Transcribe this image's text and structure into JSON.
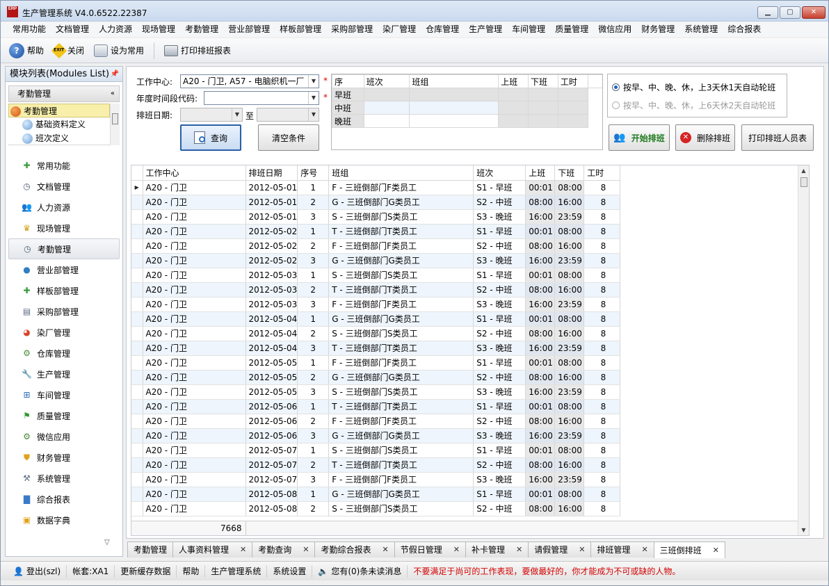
{
  "window": {
    "title": "生产管理系统 V4.0.6522.22387",
    "logo_text": "ERP"
  },
  "menu": [
    "常用功能",
    "文档管理",
    "人力资源",
    "现场管理",
    "考勤管理",
    "营业部管理",
    "样板部管理",
    "采购部管理",
    "染厂管理",
    "仓库管理",
    "生产管理",
    "车间管理",
    "质量管理",
    "微信应用",
    "财务管理",
    "系统管理",
    "综合报表"
  ],
  "toolbar": {
    "help": "帮助",
    "close": "关闭",
    "set_common": "设为常用",
    "print_report": "打印排班报表",
    "exit_badge": "EXIT"
  },
  "sidebar": {
    "title": "模块列表(Modules List)",
    "section": "考勤管理",
    "tree": [
      "考勤管理",
      "基础资料定义",
      "班次定义"
    ],
    "nav": [
      {
        "label": "常用功能",
        "icon": "puzzle-icon"
      },
      {
        "label": "文档管理",
        "icon": "clock-icon"
      },
      {
        "label": "人力资源",
        "icon": "people-icon"
      },
      {
        "label": "现场管理",
        "icon": "crown-icon"
      },
      {
        "label": "考勤管理",
        "icon": "clock-icon"
      },
      {
        "label": "营业部管理",
        "icon": "globe-icon"
      },
      {
        "label": "样板部管理",
        "icon": "puzzle-icon"
      },
      {
        "label": "采购部管理",
        "icon": "list-icon"
      },
      {
        "label": "染厂管理",
        "icon": "pie-icon"
      },
      {
        "label": "仓库管理",
        "icon": "gear-icon"
      },
      {
        "label": "生产管理",
        "icon": "wrench-icon"
      },
      {
        "label": "车间管理",
        "icon": "org-icon"
      },
      {
        "label": "质量管理",
        "icon": "flag-icon"
      },
      {
        "label": "微信应用",
        "icon": "gear-icon"
      },
      {
        "label": "财务管理",
        "icon": "shield-icon"
      },
      {
        "label": "系统管理",
        "icon": "tools-icon"
      },
      {
        "label": "综合报表",
        "icon": "bar-chart-icon"
      },
      {
        "label": "数据字典",
        "icon": "cube-icon"
      }
    ]
  },
  "form": {
    "work_center_label": "工作中心:",
    "work_center_value": "A20 - 门卫, A57 - 电脑织机一厂",
    "period_label": "年度时间段代码:",
    "period_value": "",
    "date_label": "排班日期:",
    "date_from": "",
    "date_to": "",
    "to_label": "至",
    "query_button": "查询",
    "clear_button": "清空条件",
    "required_mark": "*"
  },
  "shift_table": {
    "headers": [
      "序",
      "班次",
      "班组",
      "上班",
      "下班",
      "工时"
    ],
    "rows": [
      "早班",
      "中班",
      "晚班"
    ]
  },
  "rotation": {
    "option1": "按早、中、晚、休，上3天休1天自动轮班",
    "option2": "按早、中、晚、休，上6天休2天自动轮班",
    "selected": 1
  },
  "actions": {
    "start": "开始排班",
    "delete": "删除排班",
    "print_staff": "打印排班人员表"
  },
  "grid": {
    "columns": [
      "工作中心",
      "排班日期",
      "序号",
      "班组",
      "班次",
      "上班",
      "下班",
      "工时"
    ],
    "rows": [
      [
        "A20 - 门卫",
        "2012-05-01",
        "1",
        "F - 三班倒部门F类员工",
        "S1 - 早班",
        "00:01",
        "08:00",
        "8"
      ],
      [
        "A20 - 门卫",
        "2012-05-01",
        "2",
        "G - 三班倒部门G类员工",
        "S2 - 中班",
        "08:00",
        "16:00",
        "8"
      ],
      [
        "A20 - 门卫",
        "2012-05-01",
        "3",
        "S - 三班倒部门S类员工",
        "S3 - 晚班",
        "16:00",
        "23:59",
        "8"
      ],
      [
        "A20 - 门卫",
        "2012-05-02",
        "1",
        "T - 三班倒部门T类员工",
        "S1 - 早班",
        "00:01",
        "08:00",
        "8"
      ],
      [
        "A20 - 门卫",
        "2012-05-02",
        "2",
        "F - 三班倒部门F类员工",
        "S2 - 中班",
        "08:00",
        "16:00",
        "8"
      ],
      [
        "A20 - 门卫",
        "2012-05-02",
        "3",
        "G - 三班倒部门G类员工",
        "S3 - 晚班",
        "16:00",
        "23:59",
        "8"
      ],
      [
        "A20 - 门卫",
        "2012-05-03",
        "1",
        "S - 三班倒部门S类员工",
        "S1 - 早班",
        "00:01",
        "08:00",
        "8"
      ],
      [
        "A20 - 门卫",
        "2012-05-03",
        "2",
        "T - 三班倒部门T类员工",
        "S2 - 中班",
        "08:00",
        "16:00",
        "8"
      ],
      [
        "A20 - 门卫",
        "2012-05-03",
        "3",
        "F - 三班倒部门F类员工",
        "S3 - 晚班",
        "16:00",
        "23:59",
        "8"
      ],
      [
        "A20 - 门卫",
        "2012-05-04",
        "1",
        "G - 三班倒部门G类员工",
        "S1 - 早班",
        "00:01",
        "08:00",
        "8"
      ],
      [
        "A20 - 门卫",
        "2012-05-04",
        "2",
        "S - 三班倒部门S类员工",
        "S2 - 中班",
        "08:00",
        "16:00",
        "8"
      ],
      [
        "A20 - 门卫",
        "2012-05-04",
        "3",
        "T - 三班倒部门T类员工",
        "S3 - 晚班",
        "16:00",
        "23:59",
        "8"
      ],
      [
        "A20 - 门卫",
        "2012-05-05",
        "1",
        "F - 三班倒部门F类员工",
        "S1 - 早班",
        "00:01",
        "08:00",
        "8"
      ],
      [
        "A20 - 门卫",
        "2012-05-05",
        "2",
        "G - 三班倒部门G类员工",
        "S2 - 中班",
        "08:00",
        "16:00",
        "8"
      ],
      [
        "A20 - 门卫",
        "2012-05-05",
        "3",
        "S - 三班倒部门S类员工",
        "S3 - 晚班",
        "16:00",
        "23:59",
        "8"
      ],
      [
        "A20 - 门卫",
        "2012-05-06",
        "1",
        "T - 三班倒部门T类员工",
        "S1 - 早班",
        "00:01",
        "08:00",
        "8"
      ],
      [
        "A20 - 门卫",
        "2012-05-06",
        "2",
        "F - 三班倒部门F类员工",
        "S2 - 中班",
        "08:00",
        "16:00",
        "8"
      ],
      [
        "A20 - 门卫",
        "2012-05-06",
        "3",
        "G - 三班倒部门G类员工",
        "S3 - 晚班",
        "16:00",
        "23:59",
        "8"
      ],
      [
        "A20 - 门卫",
        "2012-05-07",
        "1",
        "S - 三班倒部门S类员工",
        "S1 - 早班",
        "00:01",
        "08:00",
        "8"
      ],
      [
        "A20 - 门卫",
        "2012-05-07",
        "2",
        "T - 三班倒部门T类员工",
        "S2 - 中班",
        "08:00",
        "16:00",
        "8"
      ],
      [
        "A20 - 门卫",
        "2012-05-07",
        "3",
        "F - 三班倒部门F类员工",
        "S3 - 晚班",
        "16:00",
        "23:59",
        "8"
      ],
      [
        "A20 - 门卫",
        "2012-05-08",
        "1",
        "G - 三班倒部门G类员工",
        "S1 - 早班",
        "00:01",
        "08:00",
        "8"
      ],
      [
        "A20 - 门卫",
        "2012-05-08",
        "2",
        "S - 三班倒部门S类员工",
        "S2 - 中班",
        "08:00",
        "16:00",
        "8"
      ]
    ],
    "total": "7668"
  },
  "tabs": [
    {
      "label": "考勤管理",
      "closable": false
    },
    {
      "label": "人事资料管理",
      "closable": true
    },
    {
      "label": "考勤查询",
      "closable": true
    },
    {
      "label": "考勤综合报表",
      "closable": true
    },
    {
      "label": "节假日管理",
      "closable": true
    },
    {
      "label": "补卡管理",
      "closable": true
    },
    {
      "label": "请假管理",
      "closable": true
    },
    {
      "label": "排班管理",
      "closable": true
    },
    {
      "label": "三班倒排班",
      "closable": true
    }
  ],
  "status": {
    "logout": "登出(szl)",
    "account": "帐套:XA1",
    "refresh_cache": "更新缓存数据",
    "help": "帮助",
    "system": "生产管理系统",
    "settings": "系统设置",
    "messages": "您有(0)条未读消息",
    "motto": "不要满足于尚可的工作表现，要做最好的，你才能成为不可或缺的人物。"
  },
  "colors": {
    "accent": "#1e5fc6",
    "motto": "#d40000",
    "selected_tree": "#f7efaa",
    "row_alt": "#eef5fc"
  }
}
